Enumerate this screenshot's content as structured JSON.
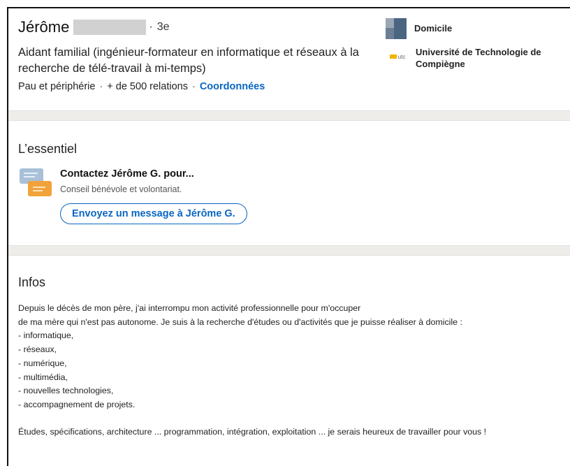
{
  "profile": {
    "name": "Jérôme",
    "degree": "3e",
    "headline": "Aidant familial (ingénieur-formateur en informatique et réseaux à la recherche de télé-travail à mi-temps)",
    "location": "Pau et périphérie",
    "connections": "+ de 500 relations",
    "contact_link": "Coordonnées",
    "current_company": "Domicile",
    "school": "Université de Technologie de Compiègne",
    "school_logo_text": "utc"
  },
  "essentials": {
    "title": "L’essentiel",
    "contact_title": "Contactez Jérôme G. pour...",
    "contact_subtitle": "Conseil bénévole et volontariat.",
    "message_button": "Envoyez un message à Jérôme G."
  },
  "about": {
    "title": "Infos",
    "intro_line1": "Depuis le décès de mon père, j'ai interrompu mon activité professionnelle pour m'occuper",
    "intro_line2": "de ma mère qui n'est pas autonome. Je suis à la recherche d'études ou d'activités que je puisse réaliser à domicile :",
    "items": [
      "- informatique,",
      "- réseaux,",
      "- numérique,",
      "- multimédia,",
      "- nouvelles technologies,",
      "- accompagnement de projets."
    ],
    "closing": "Études, spécifications, architecture ... programmation, intégration, exploitation ... je serais heureux de travailler pour vous !"
  },
  "colors": {
    "link": "#0a66c2",
    "section_band": "#eeedea",
    "message_icon_blue": "#a8c0d8",
    "message_icon_orange": "#f2a23a"
  },
  "icons": {
    "company": "company-logo-icon",
    "school": "school-logo-icon",
    "message": "message-bubbles-icon"
  }
}
